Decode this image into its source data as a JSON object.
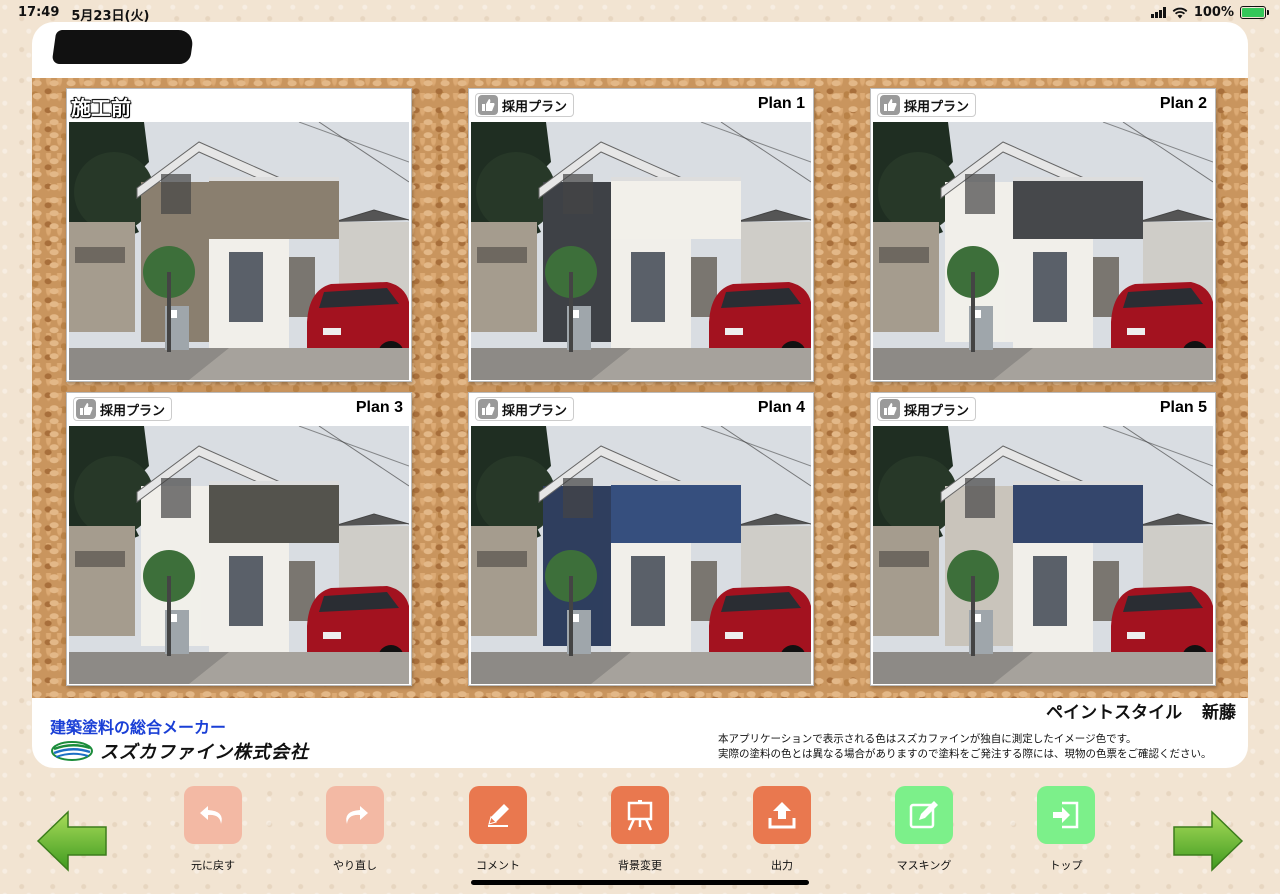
{
  "status_bar": {
    "time": "17:49",
    "date": "5月23日(火)",
    "battery_percent": "100%",
    "battery_level": 1.0
  },
  "cards": [
    {
      "type": "before",
      "label": "施工前"
    },
    {
      "type": "plan",
      "adopt_label": "採用プラン",
      "plan_label": "Plan 1",
      "wall_color": "#3e4146",
      "band_color": "#f2f0ea"
    },
    {
      "type": "plan",
      "adopt_label": "採用プラン",
      "plan_label": "Plan 2",
      "wall_color": "#f1efea",
      "band_color": "#46484b"
    },
    {
      "type": "plan",
      "adopt_label": "採用プラン",
      "plan_label": "Plan 3",
      "wall_color": "#f1efea",
      "band_color": "#54534d"
    },
    {
      "type": "plan",
      "adopt_label": "採用プラン",
      "plan_label": "Plan 4",
      "wall_color": "#2f3e5e",
      "band_color": "#364f7e"
    },
    {
      "type": "plan",
      "adopt_label": "採用プラン",
      "plan_label": "Plan 5",
      "wall_color": "#c9c4bb",
      "band_color": "#34466c"
    }
  ],
  "footer": {
    "tagline": "建築塗料の総合メーカー",
    "company": "スズカファイン株式会社",
    "store": "ペイントスタイル 新藤",
    "disclaimer_1": "本アプリケーションで表示される色はスズカファインが独自に測定したイメージ色です。",
    "disclaimer_2": "実際の塗料の色とは異なる場合がありますので塗料をご発注する際には、現物の色票をご確認ください。"
  },
  "toolbar": {
    "undo": "元に戻す",
    "redo": "やり直し",
    "comment": "コメント",
    "background": "背景変更",
    "output": "出力",
    "masking": "マスキング",
    "top": "トップ"
  },
  "colors": {
    "accent_light": "#f3b9a4",
    "accent_orange": "#e9784f",
    "accent_green": "#7cf08a",
    "tagline_blue": "#1a3fd6",
    "cork": "#c9955e"
  }
}
